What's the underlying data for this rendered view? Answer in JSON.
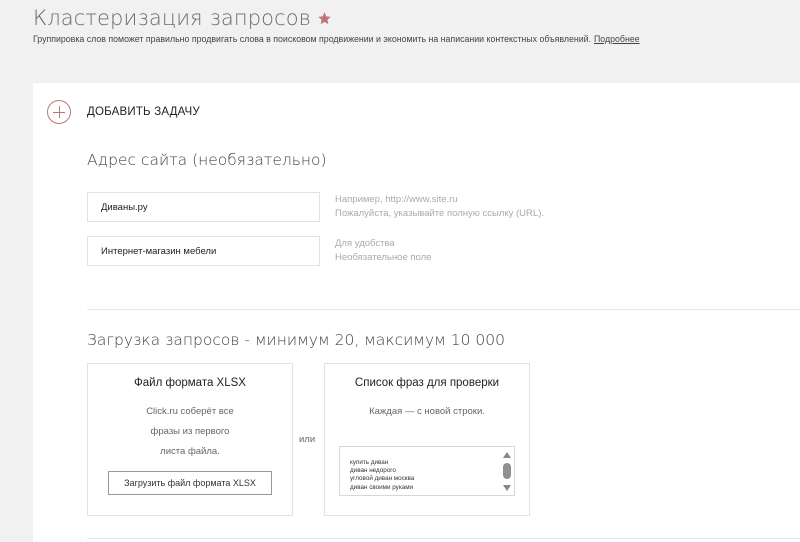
{
  "header": {
    "title": "Кластеризация запросов",
    "subtitle": "Группировка слов поможет правильно продвигать слова в поисковом продвижении и экономить на написании контекстных объявлений.",
    "more_link": "Подробнее",
    "star_icon": "star-icon",
    "accent_color": "#c0737a"
  },
  "add_task": {
    "label": "ДОБАВИТЬ ЗАДАЧУ",
    "icon": "plus-circle-icon"
  },
  "site_section": {
    "title": "Адрес сайта (необязательно)",
    "site_input": {
      "value": "Диваны.ру",
      "hint_1": "Например, http://www.site.ru",
      "hint_2": "Пожалуйста, указывайте полную ссылку (URL)."
    },
    "name_input": {
      "value": "Интернет-магазин мебели",
      "hint_1": "Для удобства",
      "hint_2": "Необязательное поле"
    }
  },
  "upload_section": {
    "title": "Загрузка запросов - минимум 20, максимум 10 000",
    "xlsx_card": {
      "title": "Файл формата XLSX",
      "lines": [
        "Click.ru соберёт все",
        "фразы из первого",
        "листа файла."
      ],
      "button": "Загрузить файл формата XLSX"
    },
    "or_label": "или",
    "list_card": {
      "title": "Список фраз для проверки",
      "text": "Каждая — с новой строки.",
      "phrases": [
        "купить диван",
        "диван недорого",
        "угловой диван москва",
        "диван своими руками"
      ]
    }
  }
}
